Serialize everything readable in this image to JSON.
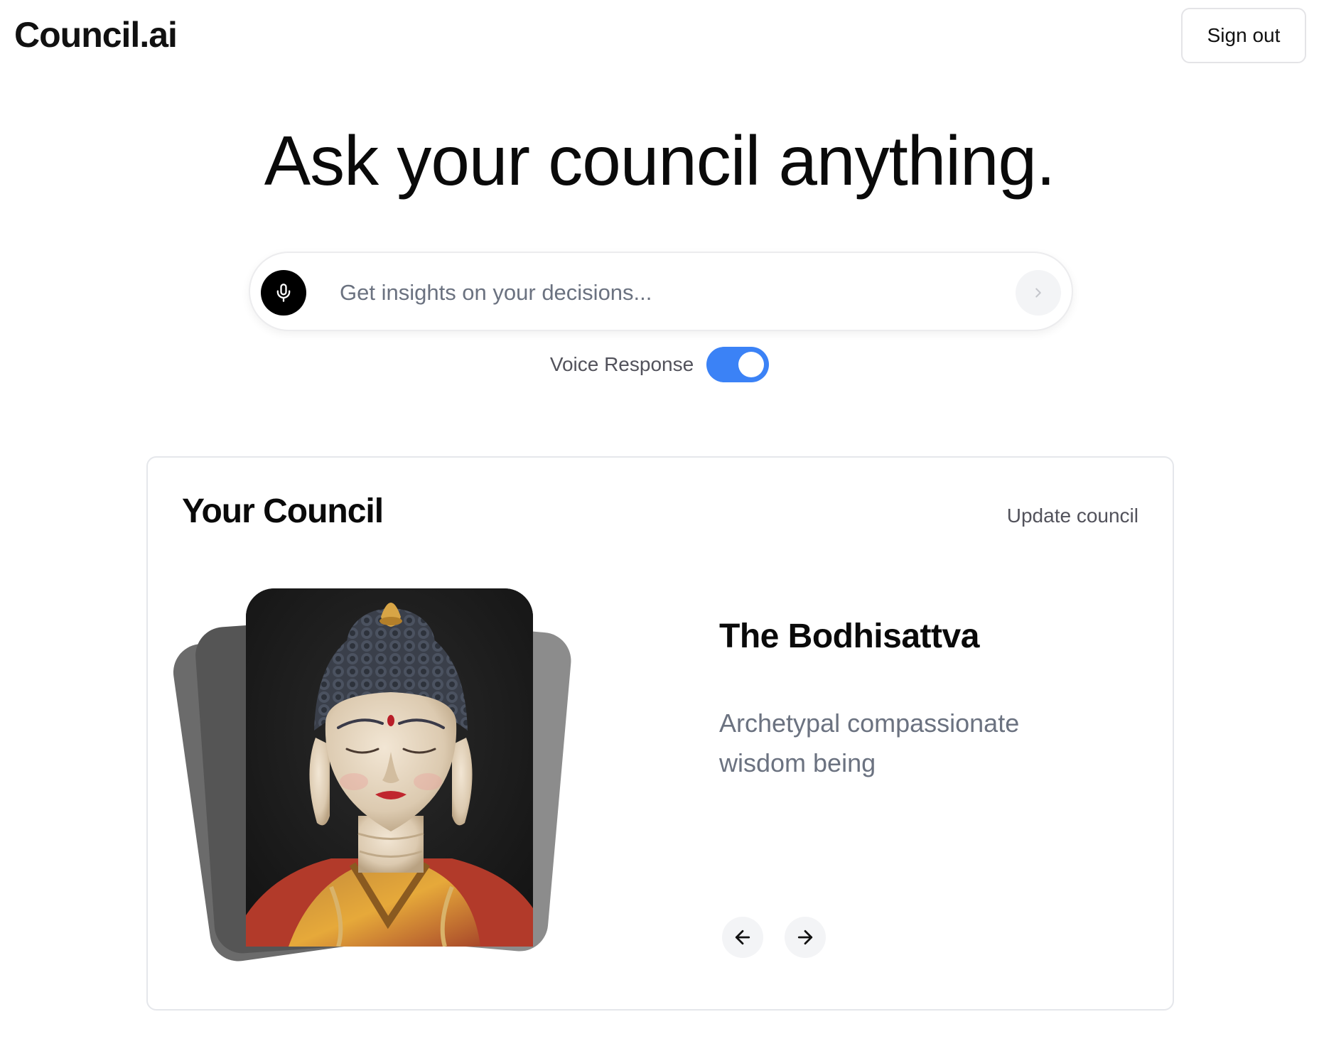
{
  "header": {
    "logo": "Council.ai",
    "sign_out_label": "Sign out"
  },
  "hero": {
    "headline": "Ask your council anything."
  },
  "search": {
    "placeholder": "Get insights on your decisions...",
    "value": "",
    "mic_icon": "microphone-icon",
    "send_icon": "chevron-right-icon"
  },
  "voice_response": {
    "label": "Voice Response",
    "enabled": true,
    "accent_color": "#3b82f6"
  },
  "council": {
    "title": "Your Council",
    "update_label": "Update council",
    "current_member": {
      "name": "The Bodhisattva",
      "description": "Archetypal compassionate wisdom being"
    },
    "nav": {
      "prev_icon": "arrow-left-icon",
      "next_icon": "arrow-right-icon"
    }
  }
}
